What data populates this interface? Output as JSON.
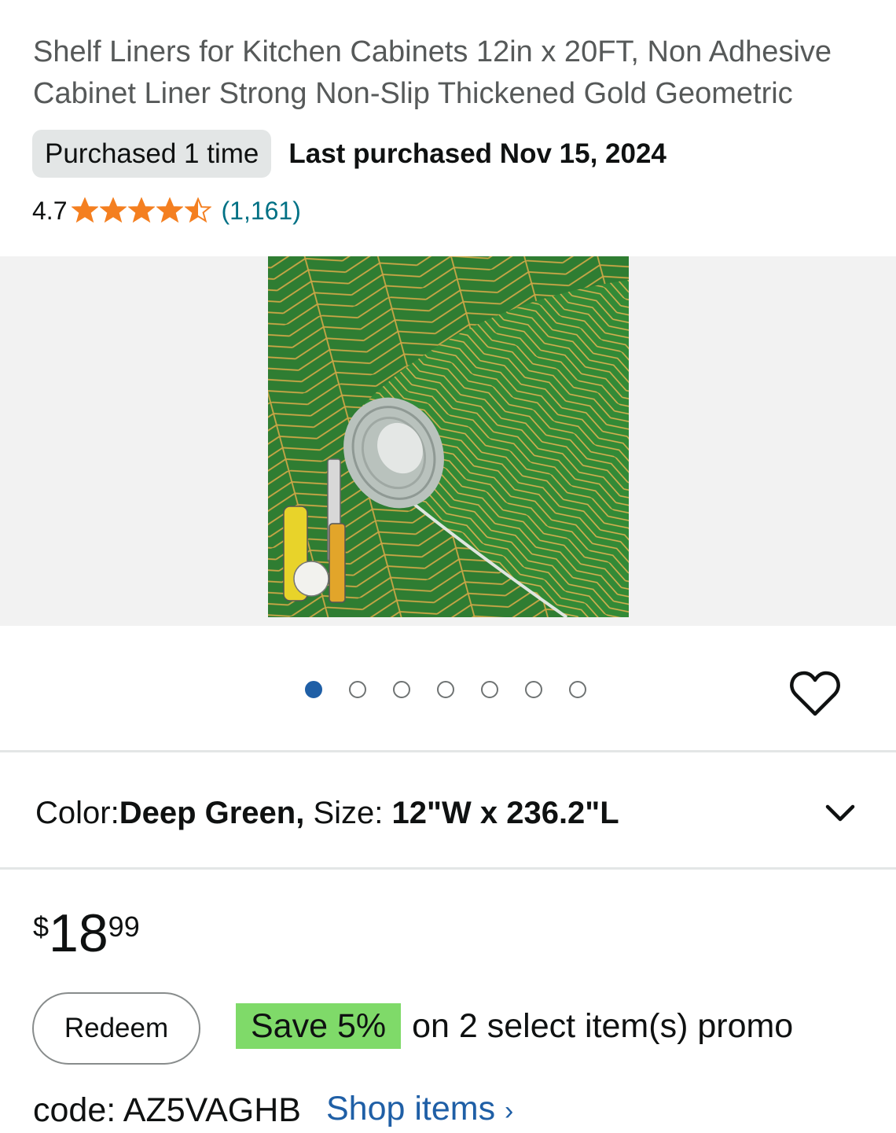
{
  "product": {
    "title": "Shelf Liners for Kitchen Cabinets 12in x 20FT, Non Adhesive Cabinet Liner Strong Non-Slip Thickened Gold Geometric",
    "purchased_badge": "Purchased 1 time",
    "last_purchased": "Last purchased Nov 15, 2024",
    "rating": "4.7",
    "rating_value": 4.7,
    "stars_max": 5,
    "review_count": "(1,161)"
  },
  "gallery": {
    "image_count": 7,
    "active_index": 0,
    "image_description_name": "green-gold-geometric-shelf-liner-roll",
    "heart_icon": "heart-outline-icon"
  },
  "variation": {
    "color_label": "Color: ",
    "color_value": "Deep Green,",
    "size_label": " Size: ",
    "size_value": "12\"W x 236.2\"L",
    "chevron_icon": "chevron-down-icon"
  },
  "price": {
    "symbol": "$",
    "whole": "18",
    "fraction": "99"
  },
  "promo": {
    "redeem_label": "Redeem",
    "save_tag": "Save 5%",
    "text": "on 2 select item(s) promo",
    "code": "code: AZ5VAGHB",
    "shop_label": "Shop items",
    "shop_chevron": "›"
  },
  "colors": {
    "star": "#f47f20",
    "link": "#007185",
    "save_tag": "#7fda69",
    "active_dot": "#1f5fa6",
    "liner_green": "#2e7d32",
    "liner_gold": "#c9a646"
  }
}
